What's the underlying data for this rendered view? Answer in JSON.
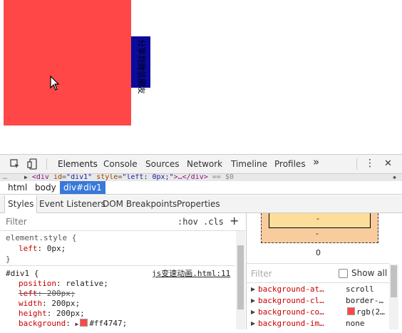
{
  "page": {
    "share_text": "分享到微信朋友"
  },
  "toolbar": {
    "tabs": [
      "Elements",
      "Console",
      "Sources",
      "Network",
      "Timeline",
      "Profiles"
    ],
    "more": "»",
    "menu": "⋮",
    "close": "✕"
  },
  "dom_line": {
    "dots": "…",
    "open": "<div ",
    "attr1_name": "id",
    "attr1_value": "\"div1\"",
    "attr2_name": "style",
    "attr2_value": "\"left: 0px;\"",
    "rest": ">…</div>",
    "eq": " == $0"
  },
  "breadcrumbs": [
    "html",
    "body",
    "div#div1"
  ],
  "subtabs": [
    "Styles",
    "Event Listeners",
    "DOM Breakpoints",
    "Properties"
  ],
  "styles": {
    "filter_placeholder": "Filter",
    "hov": ":hov",
    "cls": ".cls",
    "plus": "+",
    "element_style": {
      "selector": "element.style {",
      "props": [
        {
          "name": "left",
          "value": "0px;"
        }
      ],
      "close": "}"
    },
    "div1_rule": {
      "selector": "#div1 {",
      "source": "js变速动画.html:11",
      "props": [
        {
          "name": "position",
          "value": "relative;"
        },
        {
          "name": "left",
          "value": "200px;",
          "struck": true
        },
        {
          "name": "width",
          "value": "200px;"
        },
        {
          "name": "height",
          "value": "200px;"
        },
        {
          "name": "background",
          "value": "#ff4747;"
        }
      ]
    }
  },
  "box_model": {
    "dash1": "-",
    "dash2": "-",
    "margin_bottom": "0"
  },
  "computed": {
    "filter_placeholder": "Filter",
    "show_all": "Show all",
    "rows": [
      {
        "name": "background-at…",
        "value": "scroll"
      },
      {
        "name": "background-cl…",
        "value": "border-…"
      },
      {
        "name": "background-co…",
        "value": "rgb(2…",
        "swatch": "#ff4747"
      },
      {
        "name": "background-im…",
        "value": "none"
      }
    ]
  },
  "colors": {
    "div1": "#ff4747",
    "share_bg": "#0a0a9c",
    "selected_crumb": "#3879d9"
  }
}
